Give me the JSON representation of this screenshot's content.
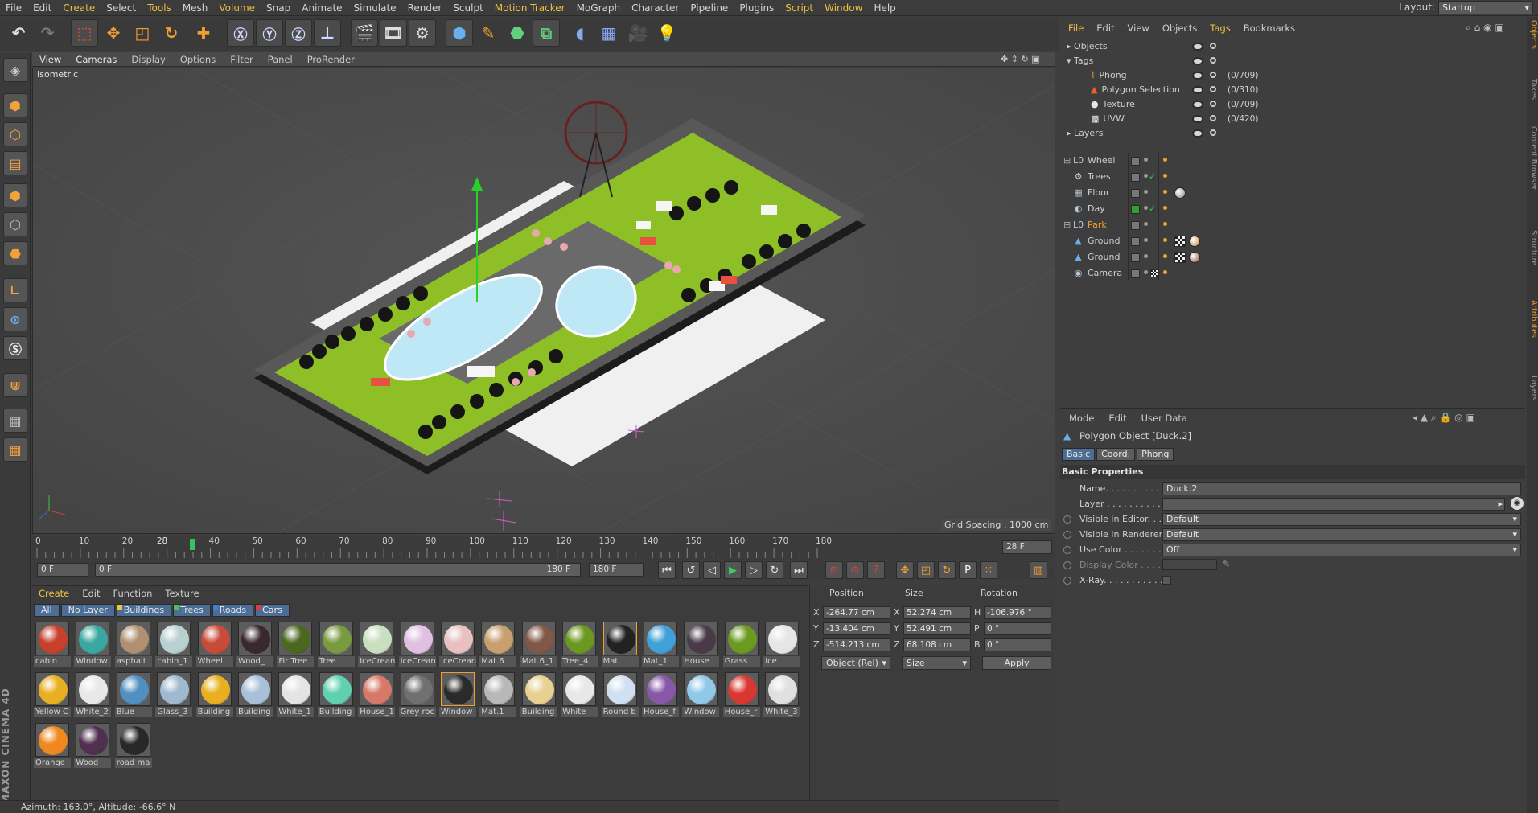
{
  "menubar": {
    "items": [
      {
        "label": "File",
        "hl": false
      },
      {
        "label": "Edit",
        "hl": false
      },
      {
        "label": "Create",
        "hl": true
      },
      {
        "label": "Select",
        "hl": false
      },
      {
        "label": "Tools",
        "hl": true
      },
      {
        "label": "Mesh",
        "hl": false
      },
      {
        "label": "Volume",
        "hl": true
      },
      {
        "label": "Snap",
        "hl": false
      },
      {
        "label": "Animate",
        "hl": false
      },
      {
        "label": "Simulate",
        "hl": false
      },
      {
        "label": "Render",
        "hl": false
      },
      {
        "label": "Sculpt",
        "hl": false
      },
      {
        "label": "Motion Tracker",
        "hl": true
      },
      {
        "label": "MoGraph",
        "hl": false
      },
      {
        "label": "Character",
        "hl": false
      },
      {
        "label": "Pipeline",
        "hl": false
      },
      {
        "label": "Plugins",
        "hl": false
      },
      {
        "label": "Script",
        "hl": true
      },
      {
        "label": "Window",
        "hl": true
      },
      {
        "label": "Help",
        "hl": false
      }
    ],
    "layout_label": "Layout:",
    "layout_value": "Startup"
  },
  "viewport": {
    "menu": [
      "View",
      "Cameras",
      "Display",
      "Options",
      "Filter",
      "Panel",
      "ProRender"
    ],
    "name": "Isometric",
    "grid_spacing": "Grid Spacing : 1000 cm"
  },
  "timeline": {
    "ticks": [
      "0",
      "10",
      "20",
      "28",
      "40",
      "50",
      "60",
      "70",
      "80",
      "90",
      "100",
      "110",
      "120",
      "130",
      "140",
      "150",
      "160",
      "170",
      "180"
    ],
    "current_frame": "28 F",
    "start": "0 F",
    "range_start": "0 F",
    "range_end": "180 F",
    "end": "180 F"
  },
  "materials": {
    "menu": [
      {
        "label": "Create",
        "hl": true
      },
      {
        "label": "Edit",
        "hl": false
      },
      {
        "label": "Function",
        "hl": false
      },
      {
        "label": "Texture",
        "hl": false
      }
    ],
    "filters": [
      {
        "label": "All",
        "color": ""
      },
      {
        "label": "No Layer",
        "color": ""
      },
      {
        "label": "Buildings",
        "color": "#e8c840"
      },
      {
        "label": "Trees",
        "color": "#50c050"
      },
      {
        "label": "Roads",
        "color": "#4080d8"
      },
      {
        "label": "Cars",
        "color": "#d84040"
      }
    ],
    "items": [
      {
        "name": "cabin",
        "color": "#c8402c"
      },
      {
        "name": "Window",
        "color": "#3aa8a0"
      },
      {
        "name": "asphalt",
        "color": "#b09070"
      },
      {
        "name": "cabin_1",
        "color": "#b8d0d0"
      },
      {
        "name": "Wheel",
        "color": "#c84a38"
      },
      {
        "name": "Wood_",
        "color": "#3a2830"
      },
      {
        "name": "Fir Tree",
        "color": "#4a6820"
      },
      {
        "name": "Tree",
        "color": "#7a9a40"
      },
      {
        "name": "IceCrean",
        "color": "#c8e0c0"
      },
      {
        "name": "IceCrean",
        "color": "#e0c0e0"
      },
      {
        "name": "IceCrean",
        "color": "#e8c0c0"
      },
      {
        "name": "Mat.6",
        "color": "#c8a070"
      },
      {
        "name": "Mat.6_1",
        "color": "#805848"
      },
      {
        "name": "Tree_4",
        "color": "#6a9820"
      },
      {
        "name": "Mat",
        "color": "#222222"
      },
      {
        "name": "Mat_1",
        "color": "#40a0d8"
      },
      {
        "name": "House",
        "color": "#4a3a48"
      },
      {
        "name": "Grass",
        "color": "#6a9a20"
      },
      {
        "name": "Ice",
        "color": "#e6e6e6"
      },
      {
        "name": "Yellow C",
        "color": "#e8b020"
      },
      {
        "name": "White_2",
        "color": "#e8e8e8"
      },
      {
        "name": "Blue",
        "color": "#5090c0"
      },
      {
        "name": "Glass_3",
        "color": "#a0b8d0"
      },
      {
        "name": "Building",
        "color": "#e8b020"
      },
      {
        "name": "Building",
        "color": "#a8c0d8"
      },
      {
        "name": "White_1",
        "color": "#e4e4e4"
      },
      {
        "name": "Building",
        "color": "#60d0b0"
      },
      {
        "name": "House_1",
        "color": "#d87868"
      },
      {
        "name": "Grey roc",
        "color": "#707070"
      },
      {
        "name": "Window",
        "color": "#2a2a2a"
      },
      {
        "name": "Mat.1",
        "color": "#b8b8b8"
      },
      {
        "name": "Building",
        "color": "#e8d090"
      },
      {
        "name": "White",
        "color": "#e8e8e8"
      },
      {
        "name": "Round b",
        "color": "#d0e0f0"
      },
      {
        "name": "House_f",
        "color": "#8858a8"
      },
      {
        "name": "Window",
        "color": "#90c8e8"
      },
      {
        "name": "House_r",
        "color": "#d83830"
      },
      {
        "name": "White_3",
        "color": "#e0e0e0"
      },
      {
        "name": "Orange",
        "color": "#f08820"
      },
      {
        "name": "Wood",
        "color": "#503050"
      },
      {
        "name": "road ma",
        "color": "#282828"
      }
    ]
  },
  "coords": {
    "headers": [
      "Position",
      "Size",
      "Rotation"
    ],
    "rows": [
      {
        "axis": "X",
        "pos": "-264.77 cm",
        "saxis": "X",
        "size": "52.274 cm",
        "raxis": "H",
        "rot": "-106.976 °"
      },
      {
        "axis": "Y",
        "pos": "-13.404 cm",
        "saxis": "Y",
        "size": "52.491 cm",
        "raxis": "P",
        "rot": "0 °"
      },
      {
        "axis": "Z",
        "pos": "-514.213 cm",
        "saxis": "Z",
        "size": "68.108 cm",
        "raxis": "B",
        "rot": "0 °"
      }
    ],
    "mode": "Object (Rel)",
    "size_mode": "Size",
    "apply": "Apply"
  },
  "tagmgr": {
    "menu": [
      {
        "label": "File",
        "hl": true
      },
      {
        "label": "Edit",
        "hl": false
      },
      {
        "label": "View",
        "hl": false
      },
      {
        "label": "Objects",
        "hl": false
      },
      {
        "label": "Tags",
        "hl": true
      },
      {
        "label": "Bookmarks",
        "hl": false
      }
    ],
    "groups": [
      {
        "label": "Objects"
      },
      {
        "label": "Tags"
      }
    ],
    "tags": [
      {
        "label": "Phong",
        "count": "(0/709)"
      },
      {
        "label": "Polygon Selection",
        "count": "(0/310)"
      },
      {
        "label": "Texture",
        "count": "(0/709)"
      },
      {
        "label": "UVW",
        "count": "(0/420)"
      }
    ],
    "layers": "Layers"
  },
  "objects": [
    {
      "name": "Wheel",
      "icon": "L0",
      "orange": false,
      "check": false
    },
    {
      "name": "Trees",
      "icon": "⚙",
      "orange": false,
      "check": true
    },
    {
      "name": "Floor",
      "icon": "▦",
      "orange": false,
      "check": false
    },
    {
      "name": "Day",
      "icon": "◐",
      "orange": false,
      "check": true
    },
    {
      "name": "Park",
      "icon": "L0",
      "orange": true,
      "check": false
    },
    {
      "name": "Ground",
      "icon": "▲",
      "orange": false,
      "check": false
    },
    {
      "name": "Ground",
      "icon": "▲",
      "orange": false,
      "check": false
    },
    {
      "name": "Camera",
      "icon": "◉",
      "orange": false,
      "check": false
    }
  ],
  "attributes": {
    "menu": [
      "Mode",
      "Edit",
      "User Data"
    ],
    "title": "Polygon Object [Duck.2]",
    "tabs": [
      "Basic",
      "Coord.",
      "Phong"
    ],
    "section": "Basic Properties",
    "props": [
      {
        "label": "Name. . . . . . . . . . . .",
        "value": "Duck.2"
      },
      {
        "label": "Layer . . . . . . . . . . . .",
        "value": ""
      },
      {
        "label": "Visible in Editor. . .",
        "value": "Default"
      },
      {
        "label": "Visible in Renderer",
        "value": "Default"
      },
      {
        "label": "Use Color . . . . . . . .",
        "value": "Off"
      },
      {
        "label": "Display Color . . . .",
        "value": ""
      },
      {
        "label": "X-Ray. . . . . . . . . . .",
        "value": ""
      }
    ]
  },
  "side_tabs": [
    "Objects",
    "Takes",
    "Content Browser",
    "Structure",
    "Attributes",
    "Layers"
  ],
  "status": "Azimuth: 163.0°, Altitude: -66.6°  N",
  "brand": "MAXON CINEMA 4D"
}
